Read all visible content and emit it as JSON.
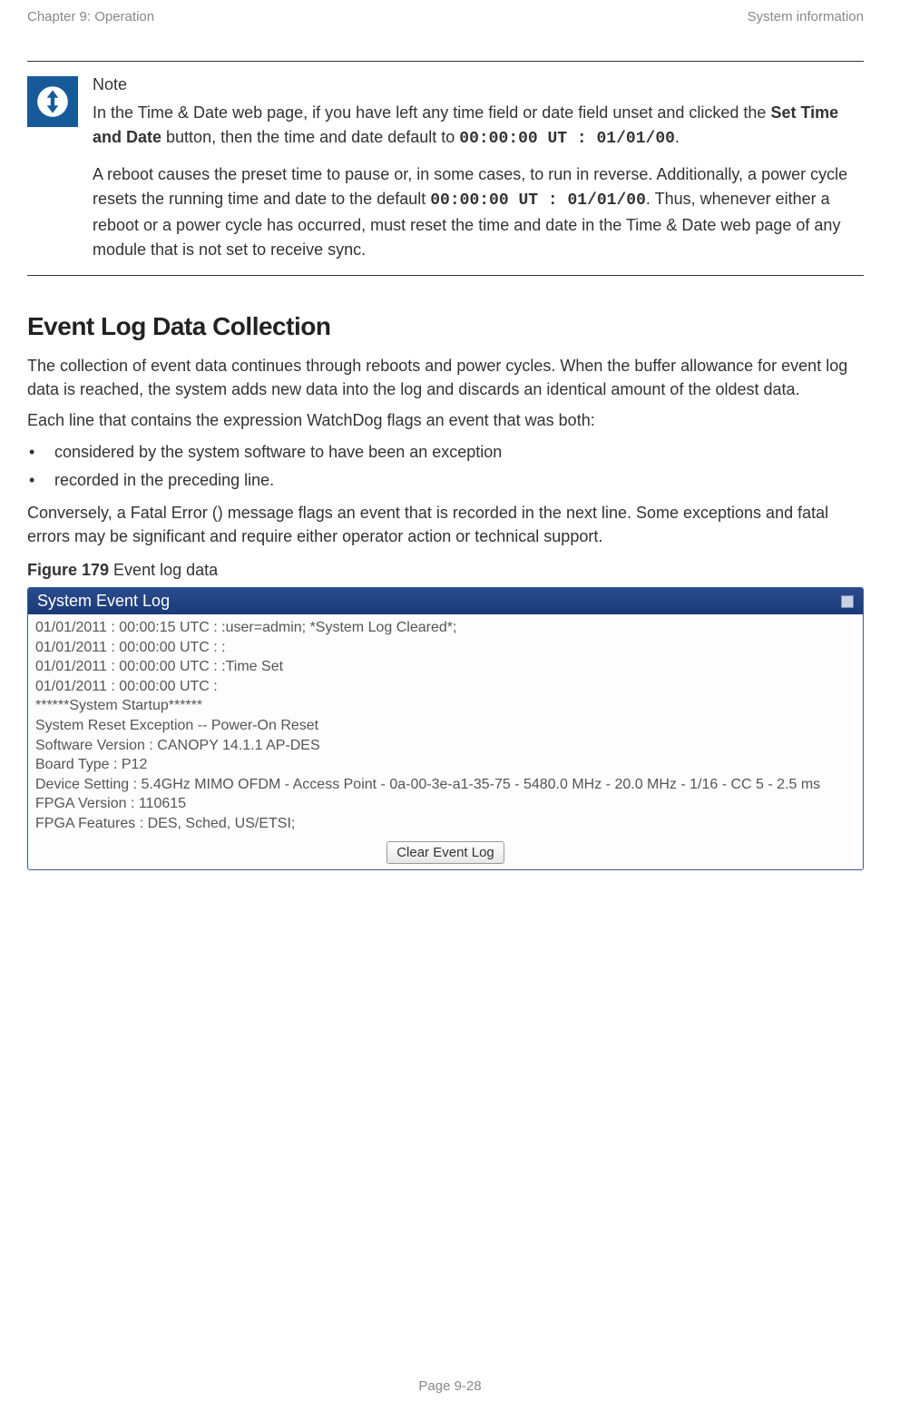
{
  "header": {
    "left": "Chapter 9:  Operation",
    "right": "System information"
  },
  "note": {
    "title": "Note",
    "p1_a": "In the Time & Date web page, if you have left any time field or date field unset and clicked the ",
    "p1_bold": "Set Time and Date",
    "p1_b": " button, then the time and date default to ",
    "p1_code1": "00:00:00 UT : 01/01/00",
    "p1_c": ".",
    "p2_a": "A reboot causes the preset time to pause or, in some cases, to run in reverse. Additionally, a power cycle resets the running time and date to the default ",
    "p2_code": "00:00:00 UT : 01/01/00",
    "p2_b": ". Thus, whenever either a reboot or a power cycle has occurred, must reset the time and date in the Time & Date web page of any module that is not set to receive sync."
  },
  "section": {
    "title": "Event Log Data Collection",
    "p1": "The collection of event data continues through reboots and power cycles. When the buffer allowance for event log data is reached, the system adds new data into the log and discards an identical amount of the oldest data.",
    "p2": "Each line that contains the expression WatchDog flags an event that was both:",
    "bullets": [
      "considered by the system software to have been an exception",
      "recorded in the preceding line."
    ],
    "p3": "Conversely, a Fatal Error () message flags an event that is recorded in the next line. Some exceptions and fatal errors may be significant and require either operator action or technical support."
  },
  "figure": {
    "caption_bold": "Figure 179",
    "caption_rest": " Event log data",
    "panel_title": "System Event Log",
    "log_lines": "01/01/2011 : 00:00:15 UTC : :user=admin; *System Log Cleared*;\n01/01/2011 : 00:00:00 UTC : :\n01/01/2011 : 00:00:00 UTC : :Time Set\n01/01/2011 : 00:00:00 UTC :\n******System Startup******\nSystem Reset Exception -- Power-On Reset\nSoftware Version : CANOPY 14.1.1 AP-DES\nBoard Type : P12\nDevice Setting : 5.4GHz MIMO OFDM - Access Point - 0a-00-3e-a1-35-75 - 5480.0 MHz - 20.0 MHz - 1/16 - CC 5 - 2.5 ms\nFPGA Version : 110615\nFPGA Features : DES, Sched, US/ETSI;",
    "clear_button": "Clear Event Log"
  },
  "footer": {
    "page": "Page 9-28"
  }
}
